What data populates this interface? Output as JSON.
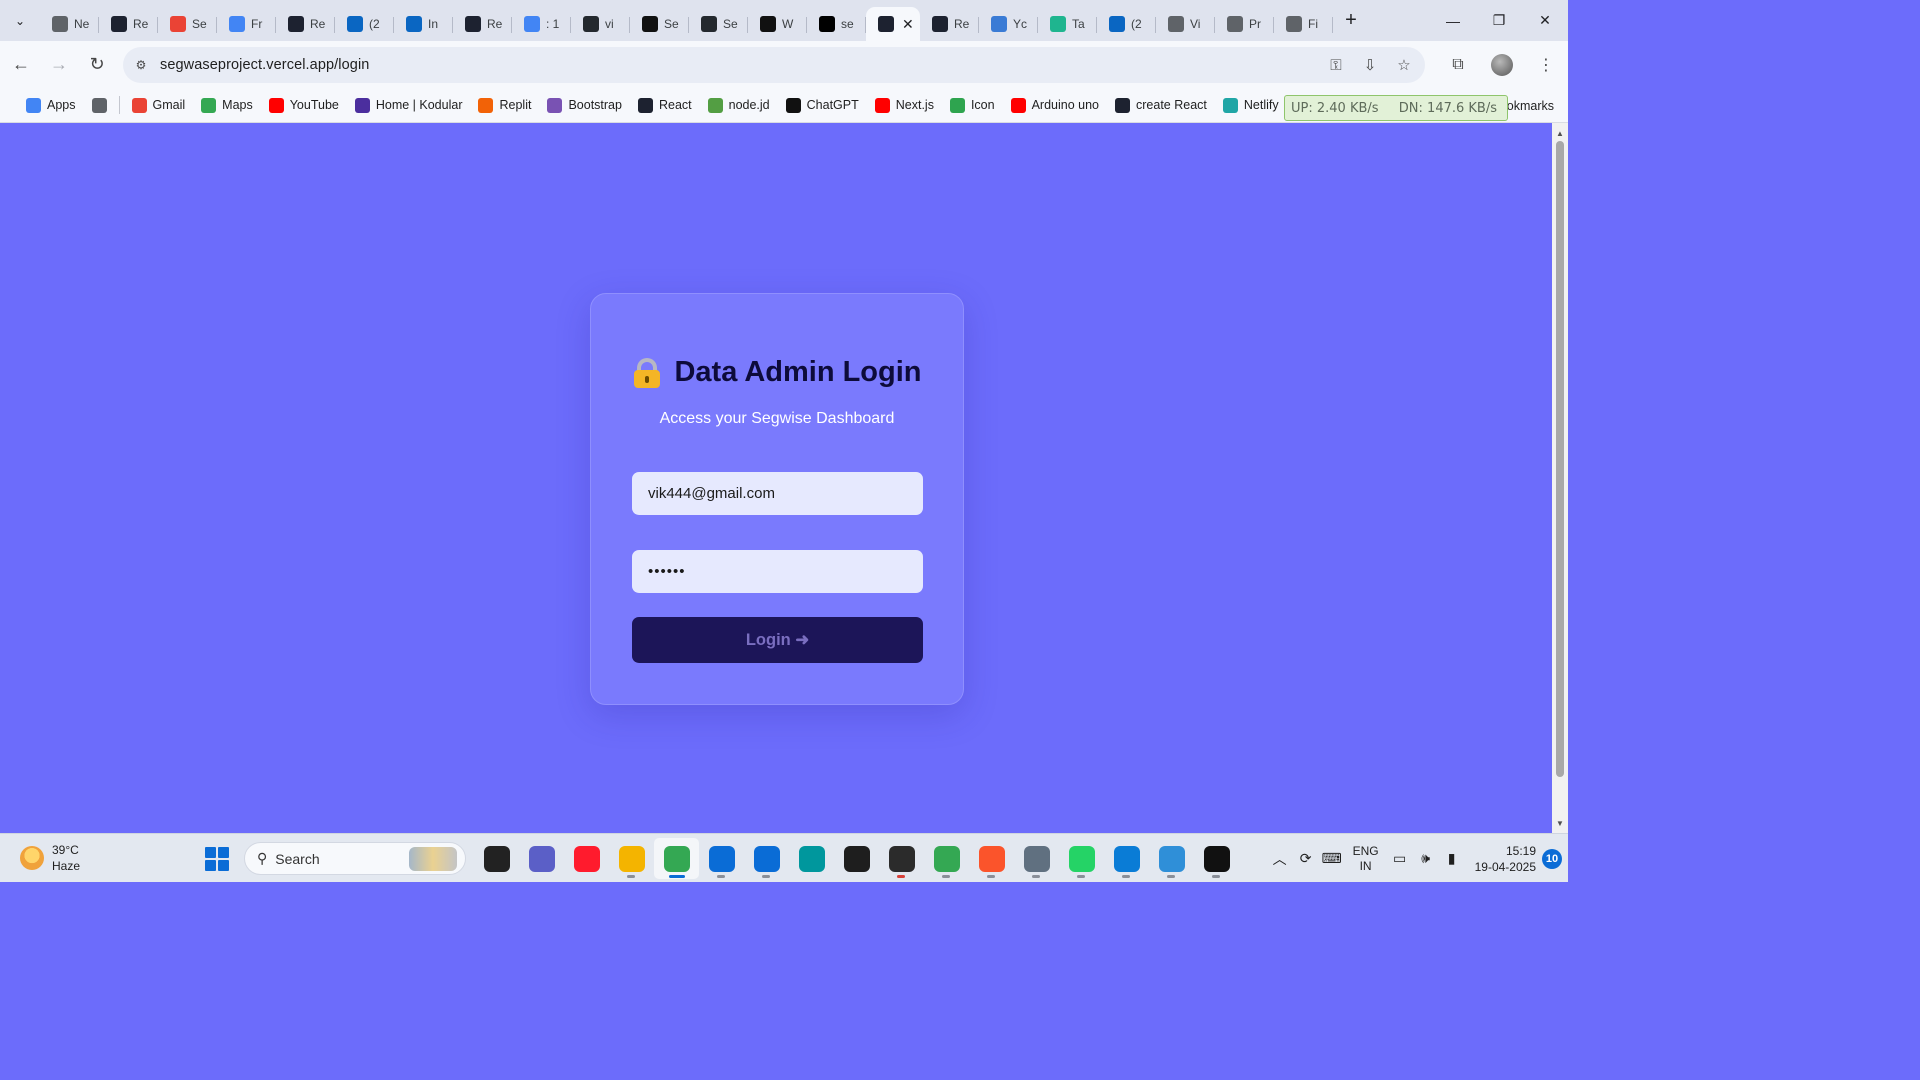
{
  "tabs": [
    {
      "title": "Ne",
      "icon": "chrome-icon",
      "color": "#5f6368"
    },
    {
      "title": "Re",
      "icon": "react-icon",
      "color": "#1d2230"
    },
    {
      "title": "Se",
      "icon": "gmail-icon",
      "color": "#ea4335"
    },
    {
      "title": "Fr",
      "icon": "docs-icon",
      "color": "#4285f4"
    },
    {
      "title": "Re",
      "icon": "react-icon",
      "color": "#1d2230"
    },
    {
      "title": "(2",
      "icon": "linkedin-icon",
      "color": "#0a66c2"
    },
    {
      "title": "In",
      "icon": "info-icon",
      "color": "#0a66c2"
    },
    {
      "title": "Re",
      "icon": "react-icon",
      "color": "#1d2230"
    },
    {
      "title": ": 1",
      "icon": "google-icon",
      "color": "#4285f4"
    },
    {
      "title": "vi",
      "icon": "github-icon",
      "color": "#24292e"
    },
    {
      "title": "Se",
      "icon": "relay-icon",
      "color": "#111111"
    },
    {
      "title": "Se",
      "icon": "github-icon",
      "color": "#24292e"
    },
    {
      "title": "W",
      "icon": "openai-icon",
      "color": "#111111"
    },
    {
      "title": "se",
      "icon": "vercel-icon",
      "color": "#000000"
    },
    {
      "title": "",
      "icon": "react-icon",
      "color": "#1d2230",
      "active": true
    },
    {
      "title": "Re",
      "icon": "react-icon",
      "color": "#1d2230"
    },
    {
      "title": "Yc",
      "icon": "site-icon",
      "color": "#3a7bd5"
    },
    {
      "title": "Ta",
      "icon": "s-icon",
      "color": "#1fb58f"
    },
    {
      "title": "(2",
      "icon": "linkedin-icon",
      "color": "#0a66c2"
    },
    {
      "title": "Vi",
      "icon": "globe-icon",
      "color": "#5f6368"
    },
    {
      "title": "Pr",
      "icon": "globe-icon",
      "color": "#5f6368"
    },
    {
      "title": "Fi",
      "icon": "globe-icon",
      "color": "#5f6368"
    }
  ],
  "address_bar": {
    "url": "segwaseproject.vercel.app/login"
  },
  "bookmarks": [
    {
      "label": "Apps",
      "icon": "apps-grid-icon",
      "color": "#4285f4"
    },
    {
      "label": "",
      "icon": "tab-groups-icon",
      "color": "#5f6368"
    },
    {
      "label": "Gmail",
      "icon": "gmail-icon",
      "color": "#ea4335"
    },
    {
      "label": "Maps",
      "icon": "maps-icon",
      "color": "#34a853"
    },
    {
      "label": "YouTube",
      "icon": "youtube-icon",
      "color": "#ff0000"
    },
    {
      "label": "Home | Kodular",
      "icon": "kodular-icon",
      "color": "#4b2e9e"
    },
    {
      "label": "Replit",
      "icon": "replit-icon",
      "color": "#f26207"
    },
    {
      "label": "Bootstrap",
      "icon": "bootstrap-icon",
      "color": "#7952b3"
    },
    {
      "label": "React",
      "icon": "react-icon",
      "color": "#1d2230"
    },
    {
      "label": "node.jd",
      "icon": "nodejs-icon",
      "color": "#539e43"
    },
    {
      "label": "ChatGPT",
      "icon": "openai-icon",
      "color": "#111111"
    },
    {
      "label": "Next.js",
      "icon": "youtube-icon",
      "color": "#ff0000"
    },
    {
      "label": "Icon",
      "icon": "icon-site-icon",
      "color": "#2ea44f"
    },
    {
      "label": "Arduino uno",
      "icon": "youtube-icon",
      "color": "#ff0000"
    },
    {
      "label": "create React",
      "icon": "react-icon",
      "color": "#1d2230"
    },
    {
      "label": "Netlify",
      "icon": "netlify-icon",
      "color": "#20a6a6"
    }
  ],
  "bookmarks_more": "okmarks",
  "net_meter": {
    "up": "UP: 2.40 KB/s",
    "down": "DN: 147.6 KB/s"
  },
  "login_card": {
    "title": "Data Admin Login",
    "subtitle": "Access your Segwise Dashboard",
    "email_value": "vik444@gmail.com",
    "password_mask": "••••••",
    "button_label": "Login ➜"
  },
  "colors": {
    "page_bg": "#6c6cfb",
    "card_bg": "#7a7afd",
    "button_bg": "#1c1558",
    "input_bg": "#e6e9fe"
  },
  "taskbar": {
    "weather_temp": "39°C",
    "weather_desc": "Haze",
    "search_placeholder": "Search",
    "apps": [
      {
        "icon": "file-explorer-black-icon",
        "color": "#222222",
        "running": false
      },
      {
        "icon": "meet-chat-icon",
        "color": "#5b5fc7",
        "running": false
      },
      {
        "icon": "opera-icon",
        "color": "#ff1b2d",
        "running": false
      },
      {
        "icon": "file-explorer-icon",
        "color": "#f4b400",
        "running": true
      },
      {
        "icon": "chrome-icon",
        "color": "#34a853",
        "running": true,
        "active": true
      },
      {
        "icon": "microsoft-store-icon",
        "color": "#0a6cd6",
        "running": true
      },
      {
        "icon": "vscode-icon",
        "color": "#0a6cd6",
        "running": true
      },
      {
        "icon": "arduino-icon",
        "color": "#00979d",
        "running": false
      },
      {
        "icon": "figma-icon",
        "color": "#1e1e1e",
        "running": false
      },
      {
        "icon": "code-editor-icon",
        "color": "#2b2b2b",
        "running": true,
        "alert": true
      },
      {
        "icon": "chrome-dev-icon",
        "color": "#34a853",
        "running": true
      },
      {
        "icon": "brave-icon",
        "color": "#fb542b",
        "running": true
      },
      {
        "icon": "settings-icon",
        "color": "#607080",
        "running": true
      },
      {
        "icon": "whatsapp-icon",
        "color": "#25d366",
        "running": true
      },
      {
        "icon": "edge-icon",
        "color": "#0a7cd6",
        "running": true
      },
      {
        "icon": "snipping-tool-icon",
        "color": "#2f8fd8",
        "running": true
      },
      {
        "icon": "chatgpt-icon",
        "color": "#111111",
        "running": true
      }
    ],
    "lang_top": "ENG",
    "lang_bottom": "IN",
    "time": "15:19",
    "date": "19-04-2025",
    "notifications": "10"
  }
}
